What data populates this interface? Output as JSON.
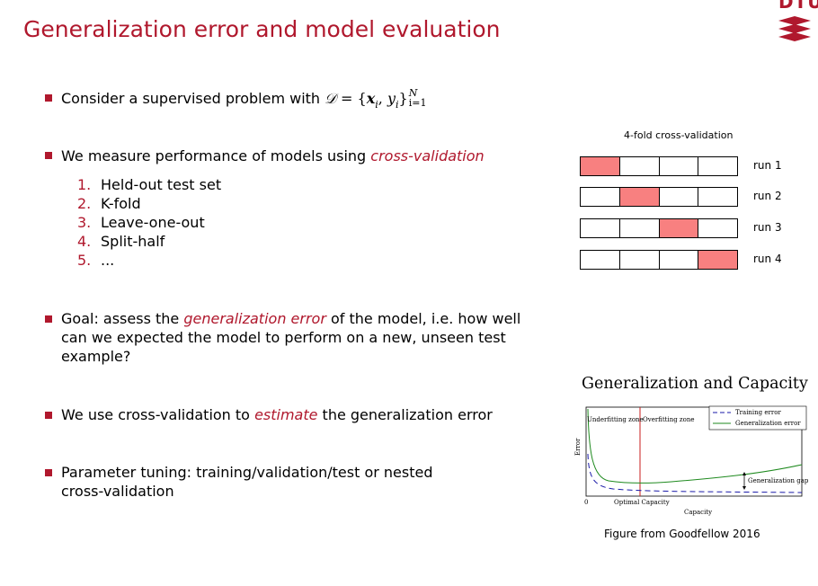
{
  "slide": {
    "title": "Generalization error and model evaluation",
    "logo_text": "DTU"
  },
  "bullets": {
    "b1_prefix": "Consider a supervised problem with",
    "b1_math": {
      "set": "𝒟",
      "eq": " = {",
      "x": "x",
      "x_sub": "i",
      "sep": ", ",
      "y": "y",
      "y_sub": "i",
      "close": "}",
      "sup": "N",
      "sub": "i=1"
    },
    "b2_prefix": "We measure performance of models using ",
    "b2_em": "cross-validation",
    "b3_prefix": "Goal: assess the ",
    "b3_em": "generalization error",
    "b3_suffix": " of the model, i.e. how well",
    "b3_line2": "can we expected the model to perform on a new, unseen test",
    "b3_line3": "example?",
    "b4_prefix": "We use cross-validation to ",
    "b4_em": "estimate",
    "b4_suffix": " the generalization error",
    "b5_line1": "Parameter tuning: training/validation/test or nested",
    "b5_line2": "cross-validation"
  },
  "methods": [
    {
      "num": "1.",
      "label": "Held-out test set"
    },
    {
      "num": "2.",
      "label": "K-fold"
    },
    {
      "num": "3.",
      "label": "Leave-one-out"
    },
    {
      "num": "4.",
      "label": "Split-half"
    },
    {
      "num": "5.",
      "label": "..."
    }
  ],
  "cv_figure": {
    "title": "4-fold cross-validation",
    "runs": [
      {
        "label": "run 1",
        "held_out_fold": 1
      },
      {
        "label": "run 2",
        "held_out_fold": 2
      },
      {
        "label": "run 3",
        "held_out_fold": 3
      },
      {
        "label": "run 4",
        "held_out_fold": 4
      }
    ],
    "folds": 4,
    "held_out_color": "#f88080"
  },
  "capacity_figure": {
    "title": "Generalization and Capacity",
    "ylabel": "Error",
    "xlabel": "Capacity",
    "x_origin": "0",
    "optimal_label": "Optimal Capacity",
    "zone_left": "Underfitting zone",
    "zone_right": "Overfitting zone",
    "gap_label": "Generalization gap",
    "legend": [
      "Training error",
      "Generalization error"
    ],
    "colors": {
      "training": "#1a1aa8",
      "generalization": "#1f8a1f",
      "optimal_line": "#c81e1e"
    }
  },
  "caption": "Figure from Goodfellow 2016",
  "colors": {
    "accent": "#b0182d"
  }
}
